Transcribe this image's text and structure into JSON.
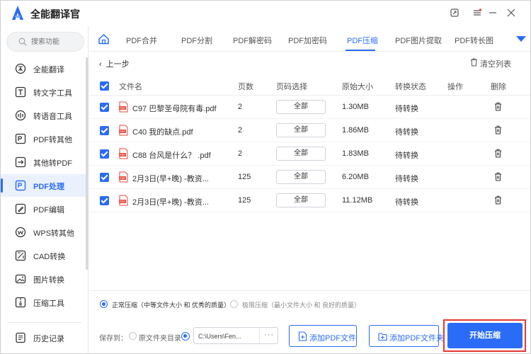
{
  "app": {
    "title": "全能翻译官"
  },
  "search": {
    "placeholder": "搜索功能"
  },
  "sidebar": {
    "items": [
      {
        "label": "全能翻译",
        "icon": "translate-icon"
      },
      {
        "label": "转文字工具",
        "icon": "text-tool-icon"
      },
      {
        "label": "转语音工具",
        "icon": "voice-tool-icon"
      },
      {
        "label": "PDF转其他",
        "icon": "pdf-convert-icon"
      },
      {
        "label": "其他转PDF",
        "icon": "to-pdf-icon"
      },
      {
        "label": "PDF处理",
        "icon": "pdf-process-icon"
      },
      {
        "label": "PDF编辑",
        "icon": "pdf-edit-icon"
      },
      {
        "label": "WPS转其他",
        "icon": "wps-icon"
      },
      {
        "label": "CAD转换",
        "icon": "cad-icon"
      },
      {
        "label": "图片转换",
        "icon": "image-convert-icon"
      },
      {
        "label": "压缩工具",
        "icon": "compress-icon"
      }
    ],
    "history": "历史记录",
    "active_index": 5
  },
  "tabs": [
    "PDF合并",
    "PDF分割",
    "PDF解密码",
    "PDF加密码",
    "PDF压缩",
    "PDF图片提取",
    "PDF转长图"
  ],
  "active_tab": "PDF压缩",
  "toolbar": {
    "back": "上一步",
    "clear": "清空列表"
  },
  "table": {
    "headers": [
      "文件名",
      "页数",
      "页码选择",
      "原始大小",
      "转换状态",
      "操作",
      "删除"
    ],
    "rows": [
      {
        "name": "C97 巴黎圣母院有毒.pdf",
        "pages": "2",
        "range": "全部",
        "size": "1.30MB",
        "status": "待转换"
      },
      {
        "name": "C40 我的缺点.pdf",
        "pages": "2",
        "range": "全部",
        "size": "1.86MB",
        "status": "待转换"
      },
      {
        "name": "C88 台风是什么？ .pdf",
        "pages": "2",
        "range": "全部",
        "size": "1.83MB",
        "status": "待转换"
      },
      {
        "name": "2月3日(早+晚) -教资...",
        "pages": "125",
        "range": "全部",
        "size": "6.20MB",
        "status": "待转换"
      },
      {
        "name": "2月3日(早+晚) -教资...",
        "pages": "125",
        "range": "全部",
        "size": "11.12MB",
        "status": "待转换"
      }
    ]
  },
  "compression": {
    "normal": "正常压缩（中等文件大小 和 优秀的质量）",
    "extreme": "极限压缩（最小文件大小 和 良好的质量）",
    "selected": "normal"
  },
  "output": {
    "save_to": "保存到：",
    "source_dir": "原文件夹目录",
    "path": "C:\\Users\\Fen...",
    "browse": "···"
  },
  "buttons": {
    "add_file": "添加PDF文件",
    "add_folder": "添加PDF文件夹",
    "start": "开始压缩"
  },
  "colors": {
    "accent": "#2a6cf6",
    "highlight": "#e53935",
    "pdf_red": "#e84a3c"
  }
}
